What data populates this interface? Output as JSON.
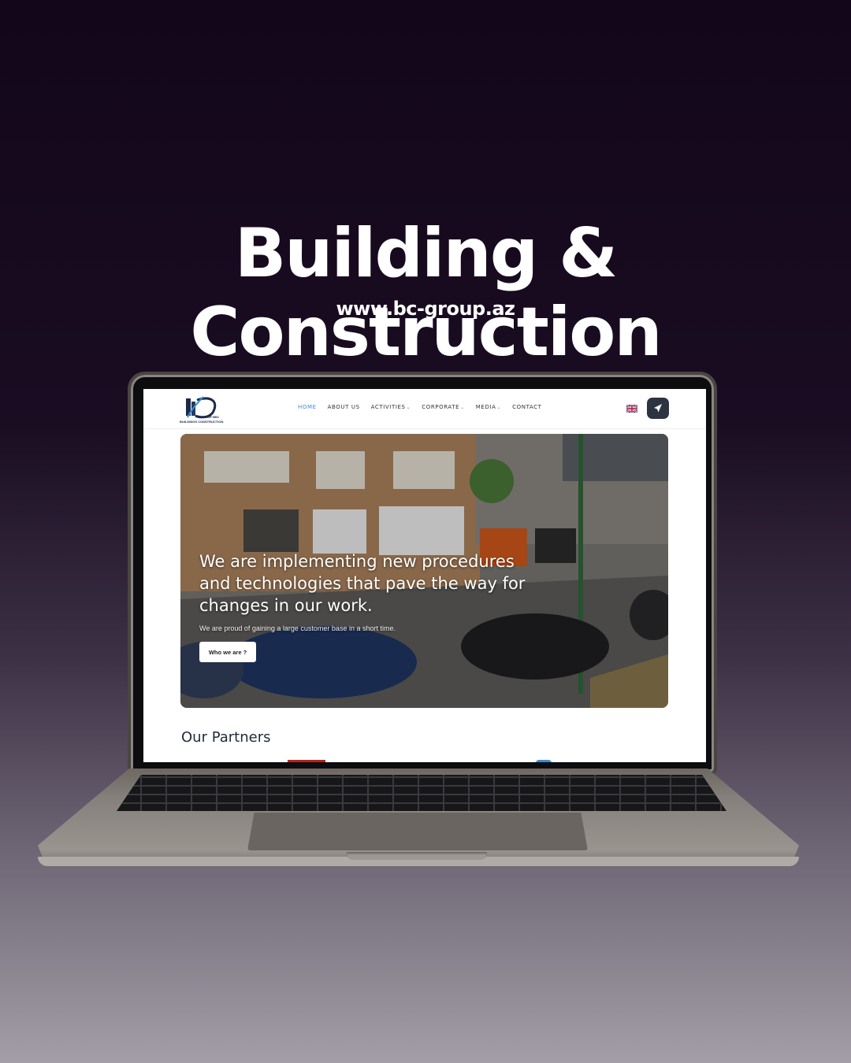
{
  "headline": "Building & Construction",
  "url": "www.bc-group.az",
  "site": {
    "logo_text": "BUILDINGS CONSTRUCTION",
    "logo_group": "GROUP MMC",
    "nav": [
      {
        "label": "HOME",
        "active": true,
        "dropdown": false
      },
      {
        "label": "ABOUT US",
        "active": false,
        "dropdown": false
      },
      {
        "label": "ACTIVITIES",
        "active": false,
        "dropdown": true
      },
      {
        "label": "CORPORATE",
        "active": false,
        "dropdown": true
      },
      {
        "label": "MEDIA",
        "active": false,
        "dropdown": true
      },
      {
        "label": "CONTACT",
        "active": false,
        "dropdown": false
      }
    ],
    "language_icon": "uk-flag-icon",
    "action_icon": "rocket-send-icon",
    "hero": {
      "heading": "We are implementing new procedures and technologies that pave the way for changes in our work.",
      "subtext": "We are proud of gaining a large customer base in a short time.",
      "button_label": "Who we are ?"
    },
    "partners_title": "Our Partners"
  },
  "colors": {
    "accent": "#3a8dd6",
    "button_dark": "#2b3440",
    "background_top": "#13061a",
    "background_bottom": "#a39ea7"
  }
}
